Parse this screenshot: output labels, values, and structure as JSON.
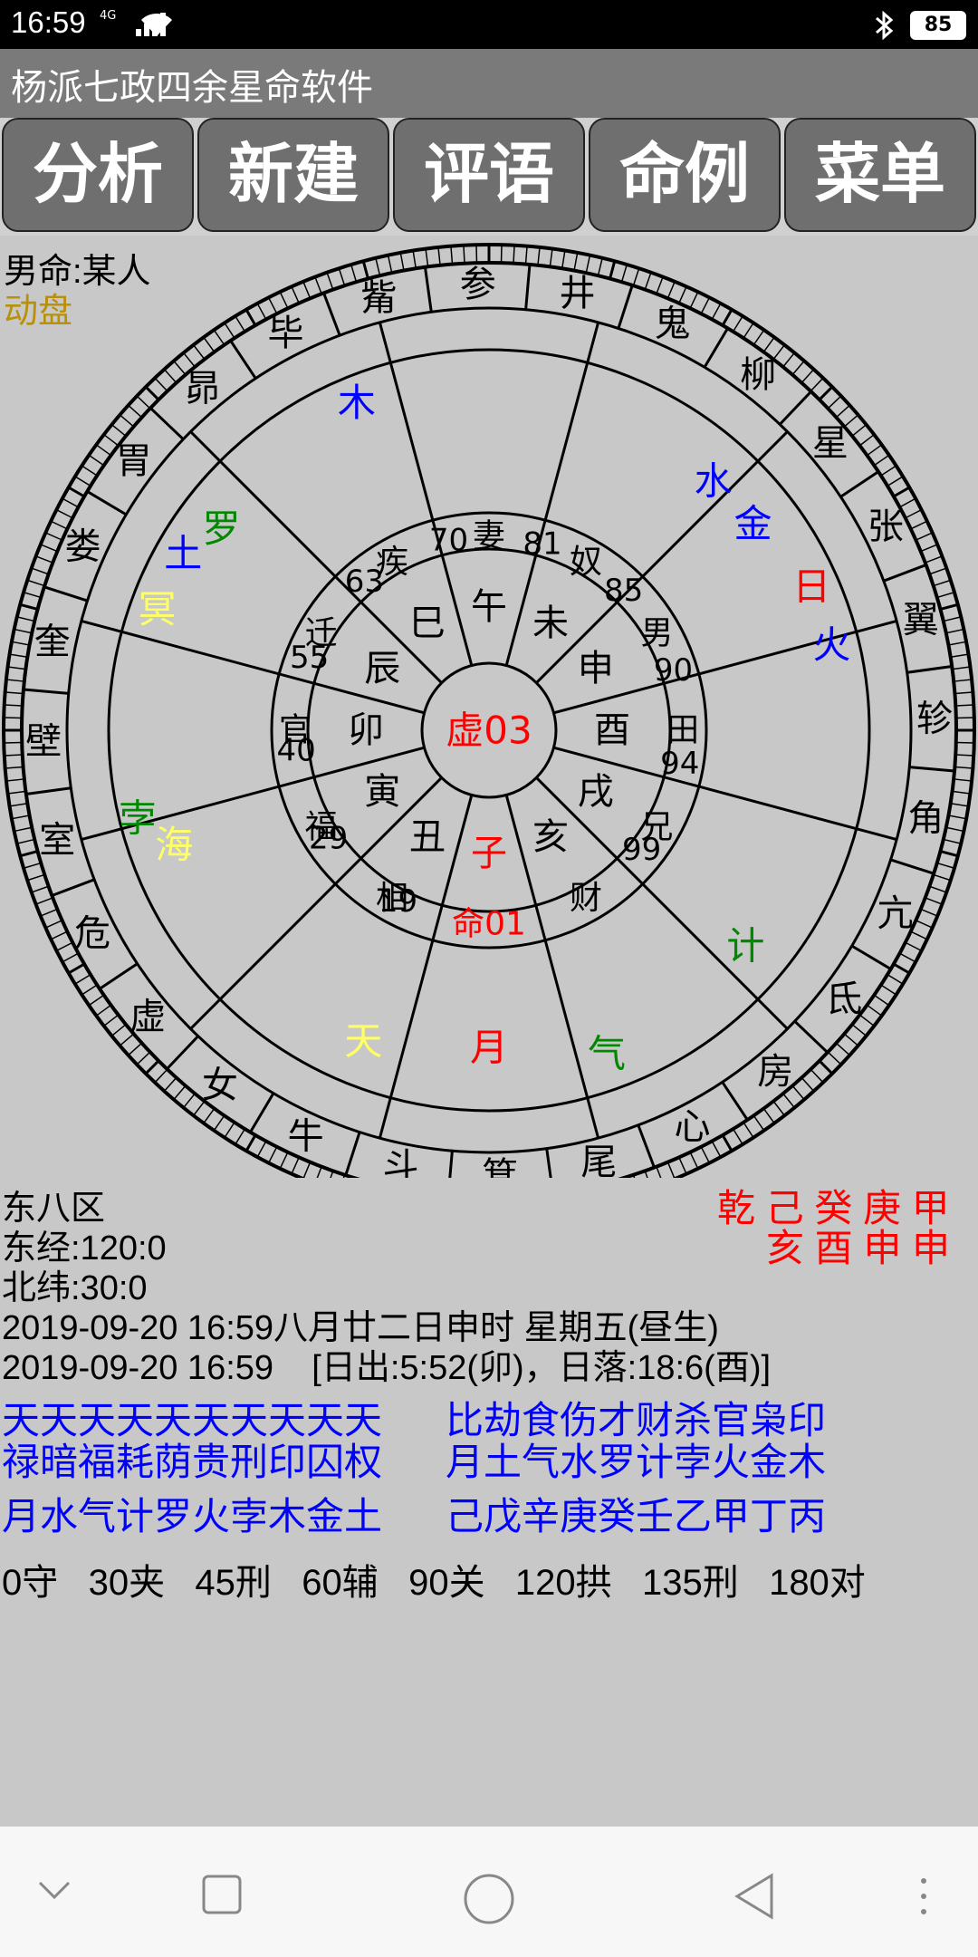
{
  "status": {
    "time": "16:59",
    "signal": "4G",
    "battery": "85"
  },
  "app": {
    "title": "杨派七政四余星命软件"
  },
  "tabs": [
    "分析",
    "新建",
    "评语",
    "命例",
    "菜单"
  ],
  "chart_meta": {
    "subject": "男命:某人",
    "mode": "动盘",
    "center_label": "虚03"
  },
  "houses": [
    "命01",
    "相",
    "福",
    "官",
    "迁",
    "疾",
    "妻",
    "奴",
    "男",
    "田",
    "兄",
    "财"
  ],
  "house_numbers": [
    "19",
    "29",
    "40",
    "55",
    "63",
    "70",
    "81",
    "85",
    "90",
    "94",
    "99"
  ],
  "branches": [
    "子",
    "丑",
    "寅",
    "卯",
    "辰",
    "巳",
    "午",
    "未",
    "申",
    "酉",
    "戌",
    "亥"
  ],
  "mansions": [
    "井",
    "鬼",
    "柳",
    "星",
    "张",
    "翼",
    "轸",
    "角",
    "亢",
    "氐",
    "房",
    "心",
    "尾",
    "箕",
    "斗",
    "牛",
    "女",
    "虚",
    "危",
    "室",
    "壁",
    "奎",
    "娄",
    "胃",
    "昴",
    "毕",
    "觜",
    "参"
  ],
  "planets": [
    "木",
    "罗",
    "土",
    "冥",
    "水",
    "金",
    "日",
    "火",
    "孛",
    "海",
    "天",
    "计",
    "气",
    "月"
  ],
  "pillars": {
    "top": "乾 己 癸 庚 甲",
    "bottom": "亥 酉 申 申"
  },
  "location": {
    "zone": "东八区",
    "longitude": "东经:120:0",
    "latitude": "北纬:30:0"
  },
  "datetime": {
    "line1": "2019-09-20 16:59八月廿二日申时 星期五(昼生)",
    "line2": "2019-09-20 16:59    [日出:5:52(卯)，日落:18:6(酉)]"
  },
  "legend": {
    "row1_left": "天天天天天天天天天天",
    "row1_right": "比劫食伤才财杀官枭印",
    "row2_left": "禄暗福耗荫贵刑印囚权",
    "row2_right": "月土气水罗计孛火金木",
    "row3_left": "月水气计罗火孛木金土",
    "row3_right": "己戊辛庚癸壬乙甲丁丙"
  },
  "aspects": "0守   30夹   45刑   60辅   90关   120拱   135刑   180对",
  "colors": {
    "blue": "#0000ff",
    "green": "#008800",
    "red": "#ff0000",
    "yellow": "#ffff66",
    "gold": "#b8900a"
  }
}
